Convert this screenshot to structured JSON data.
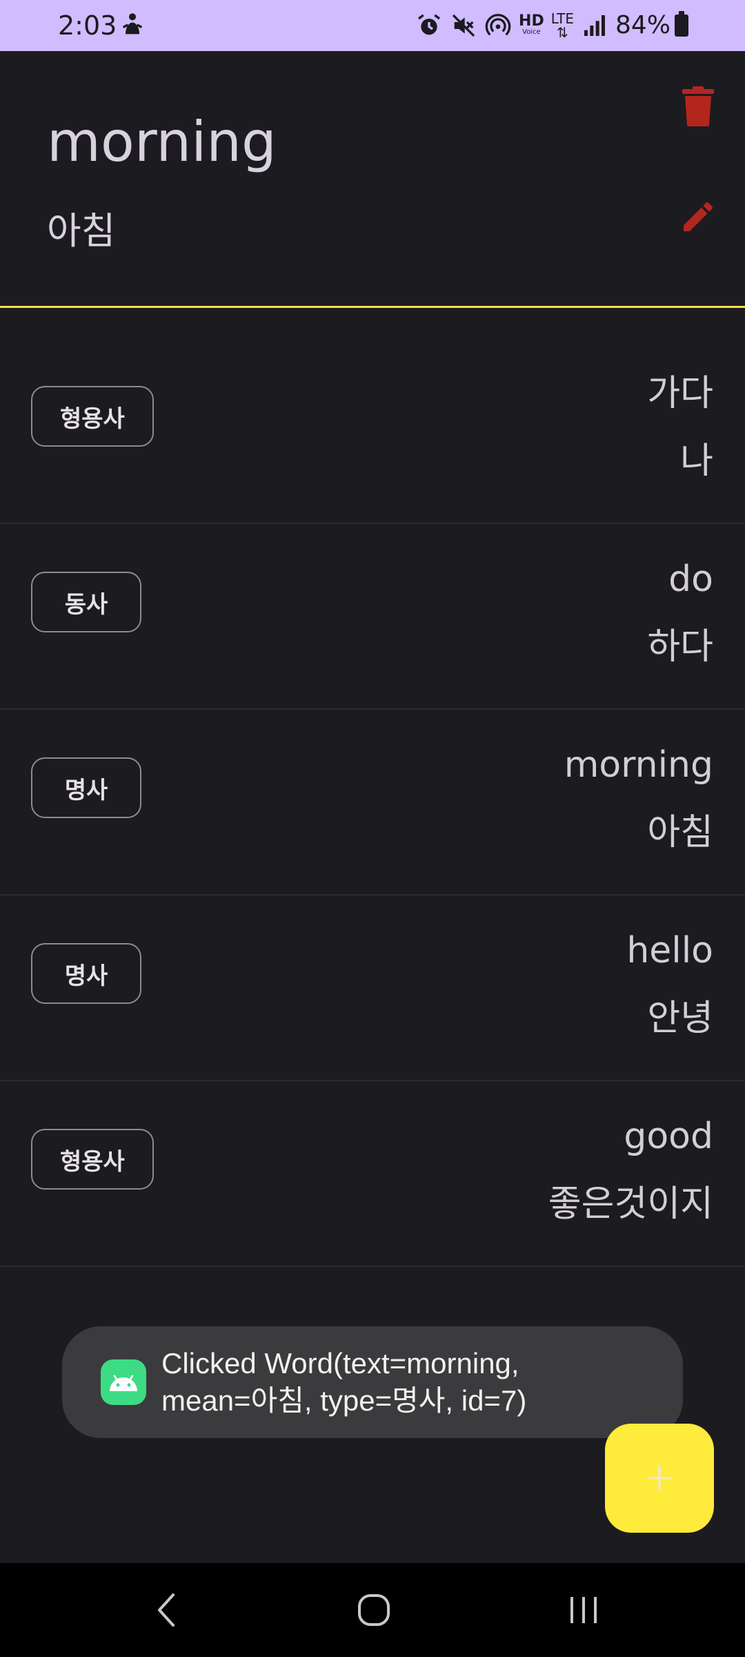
{
  "status_bar": {
    "time": "2:03",
    "hd_label": "HD",
    "hd_sub": "Voice",
    "lte_label": "LTE",
    "battery": "84%"
  },
  "header": {
    "word": "morning",
    "meaning": "아침"
  },
  "words": [
    {
      "type": "형용사",
      "text": "가다",
      "mean": "나"
    },
    {
      "type": "동사",
      "text": "do",
      "mean": "하다"
    },
    {
      "type": "명사",
      "text": "morning",
      "mean": "아침"
    },
    {
      "type": "명사",
      "text": "hello",
      "mean": "안녕"
    },
    {
      "type": "형용사",
      "text": "good",
      "mean": "좋은것이지"
    }
  ],
  "toast": {
    "line1": "Clicked Word(text=morning,",
    "line2": "mean=아침, type=명사, id=7)"
  },
  "fab": {
    "label": "+"
  },
  "colors": {
    "status_bar": "#d0bcff",
    "background": "#1c1b20",
    "header_divider": "#f2e14b",
    "action_icon": "#b3261e",
    "fab": "#ffeb3b",
    "toast": "#3b3b3d",
    "android_icon": "#3ddc84"
  },
  "icons": {
    "delete": "trash-icon",
    "edit": "pencil-icon",
    "back": "back-chevron-icon",
    "home": "home-icon",
    "recents": "recents-icon"
  }
}
